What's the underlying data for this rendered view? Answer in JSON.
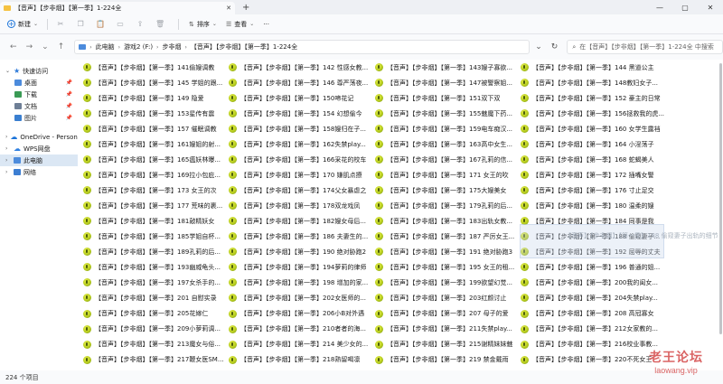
{
  "window": {
    "tab_title": "【音声】【步非烟】【第一季】1-224全",
    "tab_close": "✕",
    "new_tab": "+",
    "controls": {
      "minimize": "—",
      "maximize": "▢",
      "close": "✕"
    }
  },
  "toolbar": {
    "new_label": "新建",
    "icons": [
      "cut-icon",
      "copy-icon",
      "paste-icon",
      "rename-icon",
      "share-icon",
      "delete-icon"
    ],
    "sort_label": "排序",
    "view_label": "查看",
    "more": "···"
  },
  "address": {
    "back": "←",
    "forward": "→",
    "up_dropdown": "⌄",
    "up": "↑",
    "segments": [
      "此电脑",
      "游戏2 (F:)",
      "步非烟",
      "【音声】【步非烟】【第一季】1-224全"
    ],
    "dropdown": "⌄",
    "refresh": "↻",
    "search_placeholder": "在【音声】【步非烟】【第一季】1-224全 中搜索"
  },
  "sidebar": {
    "quick_access": "快速访问",
    "items": [
      {
        "label": "桌面",
        "icon": "desktop-icon",
        "color": "#4c8bdc"
      },
      {
        "label": "下载",
        "icon": "download-icon",
        "color": "#3a9a55"
      },
      {
        "label": "文档",
        "icon": "document-icon",
        "color": "#6e7f96"
      },
      {
        "label": "图片",
        "icon": "pictures-icon",
        "color": "#3a7fd0"
      }
    ],
    "onedrive": "OneDrive - Persona",
    "wps": "WPS网盘",
    "this_pc": "此电脑",
    "network": "网络"
  },
  "file_prefix": "【音声】【步非烟】【第一季】",
  "files": [
    "141偷嫂调教",
    "142 性感女教...",
    "143嫂子寡欲...",
    "144 黑道公主",
    "145 学姐的跟...",
    "146 尊严荡夜...",
    "147被警察姐...",
    "148教妇女子...",
    "149 隐爱",
    "150啼花记",
    "151双下双",
    "152 豪主的日常",
    "153星传有震",
    "154 幻想偷今",
    "155魅魔下药...",
    "156拯救我的虎...",
    "157 催眠调教",
    "158嫂归在子...",
    "159电车痴汉...",
    "160 女学生露裆",
    "161嫂姐的射...",
    "162失禁play...",
    "163高中女生...",
    "164 小淫荡子",
    "165瘟妖林曝...",
    "166采花的校车",
    "167孔莉的信...",
    "168 蛇蝎美人",
    "169拉小包庇...",
    "170 嫌肌点撩",
    "171 女王的吹",
    "172 插嘴女警",
    "173 女王的次",
    "174父女暴虐之",
    "175大嫂美女",
    "176 寸止足交",
    "177 荒味的裹...",
    "178双龙戏凤",
    "179孔莉的后...",
    "180 温柔的嫂",
    "181敲精妖女",
    "182嫂女母后...",
    "183出轨女教...",
    "184 同事是我",
    "185学姐自杯...",
    "186 夫妻生的...",
    "187 严厉女王...",
    "188 偷窥妻子...",
    "189孔莉的后...",
    "190 绝对胁跑2",
    "191 绝对胁跑3",
    "192 屈辱的丈夫",
    "193幽威龟头...",
    "194萝莉的律师",
    "195 女王的租...",
    "196 普通的姐...",
    "197女杀手的...",
    "198 增加的家...",
    "199欲望幻觉...",
    "200我的闺女...",
    "201 自慰实录",
    "202女医师的...",
    "203红颜讨止",
    "204失禁play...",
    "205花嫁仁",
    "206小B对外遇",
    "207 母子的爱",
    "208 高冠寡女",
    "209小萝莉调...",
    "210者者的海...",
    "211失禁play...",
    "212女家教的...",
    "213魔女与俗...",
    "214 美少女的...",
    "215谢精妹妹魅",
    "216校业事教...",
    "217鞭女医SM...",
    "218熟留喝凛",
    "219 禁金戴雨",
    "220不死女王",
    "221美女妖的...",
    "222女仆玩物",
    "223撸控就金...",
    "224失禁play..."
  ],
  "drag_ghost": {
    "text": "【音声】【步非烟】【第一季】188 偷窥妻子出轨的细节"
  },
  "status": {
    "count": "224 个项目"
  },
  "watermark": {
    "cn": "老王论坛",
    "en": "laowang.vip"
  }
}
